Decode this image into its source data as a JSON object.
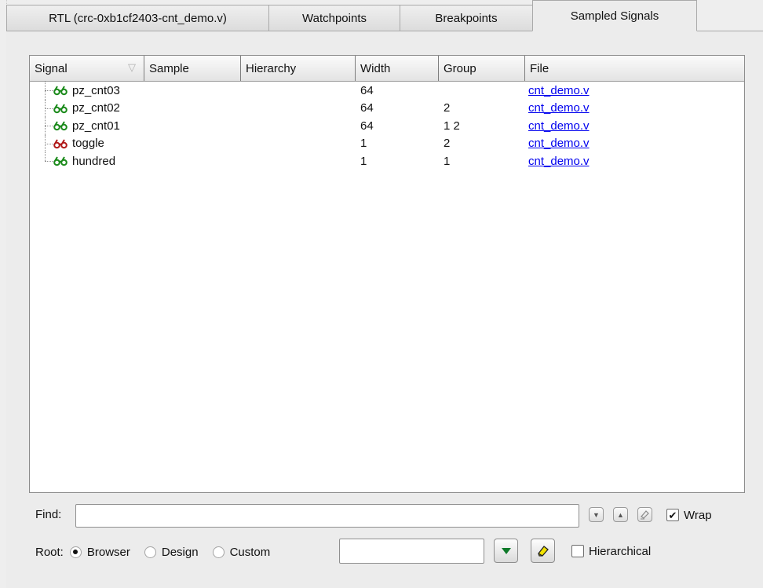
{
  "tabs": [
    {
      "label": "RTL (crc-0xb1cf2403-cnt_demo.v)",
      "active": false
    },
    {
      "label": "Watchpoints",
      "active": false
    },
    {
      "label": "Breakpoints",
      "active": false
    },
    {
      "label": "Sampled Signals",
      "active": true
    }
  ],
  "table": {
    "columns": [
      "Signal",
      "Sample",
      "Hierarchy",
      "Width",
      "Group",
      "File"
    ],
    "rows": [
      {
        "signal": "pz_cnt03",
        "sample": "",
        "hierarchy": "",
        "width": "64",
        "group": "",
        "file": "cnt_demo.v",
        "icon_color": "#1a8a1a"
      },
      {
        "signal": "pz_cnt02",
        "sample": "",
        "hierarchy": "",
        "width": "64",
        "group": "2",
        "file": "cnt_demo.v",
        "icon_color": "#1a8a1a"
      },
      {
        "signal": "pz_cnt01",
        "sample": "",
        "hierarchy": "",
        "width": "64",
        "group": "1 2",
        "file": "cnt_demo.v",
        "icon_color": "#1a8a1a"
      },
      {
        "signal": "toggle",
        "sample": "",
        "hierarchy": "",
        "width": "1",
        "group": "2",
        "file": "cnt_demo.v",
        "icon_color": "#b01818"
      },
      {
        "signal": "hundred",
        "sample": "",
        "hierarchy": "",
        "width": "1",
        "group": "1",
        "file": "cnt_demo.v",
        "icon_color": "#1a8a1a"
      }
    ]
  },
  "find": {
    "label": "Find:",
    "value": "",
    "wrap_label": "Wrap",
    "wrap_checked": true
  },
  "root": {
    "label": "Root:",
    "options": [
      "Browser",
      "Design",
      "Custom"
    ],
    "selected": "Browser",
    "custom_value": "",
    "hierarchical_label": "Hierarchical",
    "hierarchical_checked": false
  },
  "colors": {
    "link": "#0000ee",
    "go_button_arrow": "#0f7a2a",
    "eraser": "#f2e200"
  }
}
